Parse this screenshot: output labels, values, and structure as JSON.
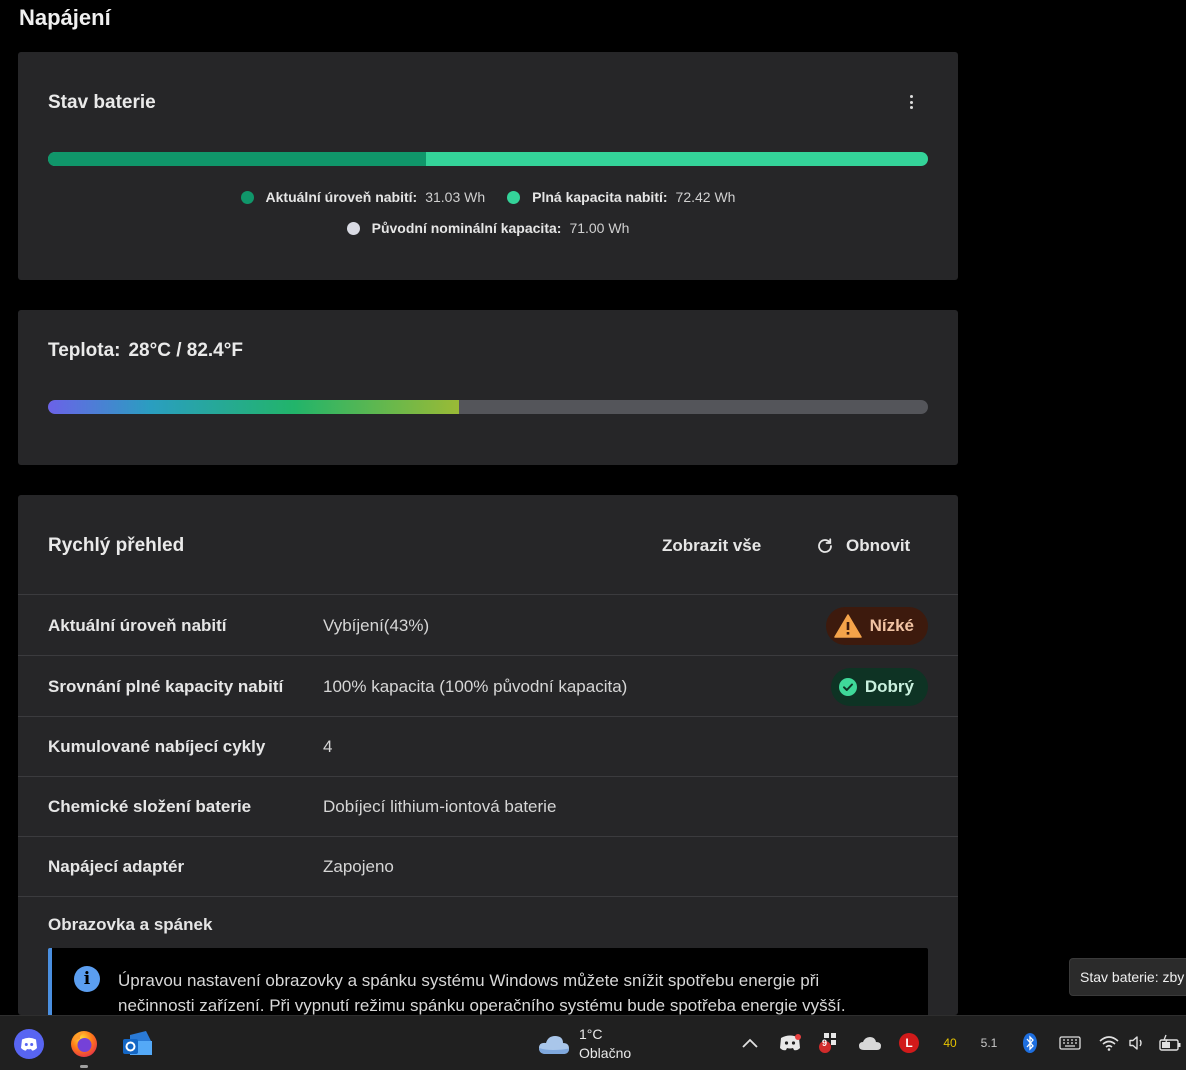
{
  "page": {
    "title": "Napájení"
  },
  "battery": {
    "title": "Stav baterie",
    "menu_icon": "more-vertical-icon",
    "level_fraction": 0.43,
    "colors": {
      "current": "#10966a",
      "full": "#34d399",
      "original": "#d9dbe4"
    },
    "legend": [
      {
        "label": "Aktuální úroveň nabití:",
        "value": "31.03 Wh"
      },
      {
        "label": "Plná kapacita nabití:",
        "value": "72.42 Wh"
      },
      {
        "label": "Původní nominální kapacita:",
        "value": "71.00 Wh"
      }
    ]
  },
  "temperature": {
    "label": "Teplota:",
    "value": "28°C / 82.4°F",
    "level_fraction": 0.467
  },
  "overview": {
    "title": "Rychlý přehled",
    "show_all": "Zobrazit vše",
    "refresh": "Obnovit",
    "rows": [
      {
        "label": "Aktuální úroveň nabití",
        "value": "Vybíjení(43%)",
        "badge": "Nízké"
      },
      {
        "label": "Srovnání plné kapacity nabití",
        "value": "100% kapacita (100% původní kapacita)",
        "badge": "Dobrý"
      },
      {
        "label": "Kumulované nabíjecí cykly",
        "value": "4"
      },
      {
        "label": "Chemické složení baterie",
        "value": "Dobíjecí lithium-iontová baterie"
      },
      {
        "label": "Napájecí adaptér",
        "value": "Zapojeno"
      }
    ],
    "screen_sleep": {
      "title": "Obrazovka a spánek",
      "info": "Úpravou nastavení obrazovky a spánku systému Windows můžete snížit spotřebu energie při nečinnosti zařízení. Při vypnutí režimu spánku operačního systému bude spotřeba energie vyšší."
    }
  },
  "tooltip": "Stav baterie: zby",
  "taskbar": {
    "apps": [
      "discord-icon",
      "firefox-icon",
      "outlook-icon"
    ],
    "weather": {
      "temp": "1°C",
      "condition": "Oblačno"
    },
    "tray": {
      "badge_count": "9",
      "avatar_letter": "L",
      "num1": "40",
      "num2": "5.1"
    }
  }
}
